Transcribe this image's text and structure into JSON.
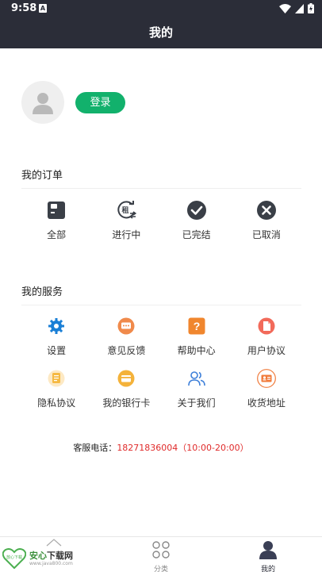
{
  "status_bar": {
    "time": "9:58",
    "notif_letter": "A"
  },
  "header": {
    "title": "我的"
  },
  "profile": {
    "login_label": "登录"
  },
  "orders": {
    "title": "我的订单",
    "items": [
      {
        "label": "全部",
        "icon": "order-box-icon"
      },
      {
        "label": "进行中",
        "icon": "rent-exchange-icon",
        "icon_text": "租"
      },
      {
        "label": "已完结",
        "icon": "check-circle-icon"
      },
      {
        "label": "已取消",
        "icon": "cancel-circle-icon"
      }
    ]
  },
  "services": {
    "title": "我的服务",
    "items": [
      {
        "label": "设置",
        "icon": "gear-icon",
        "color": "#1a7fd6"
      },
      {
        "label": "意见反馈",
        "icon": "chat-bubble-icon",
        "color": "#f08a4b"
      },
      {
        "label": "帮助中心",
        "icon": "question-icon",
        "color": "#f0862e"
      },
      {
        "label": "用户协议",
        "icon": "document-icon",
        "color": "#f26a5a"
      },
      {
        "label": "隐私协议",
        "icon": "privacy-doc-icon",
        "color": "#f5b942"
      },
      {
        "label": "我的银行卡",
        "icon": "bank-card-icon",
        "color": "#f4b23a"
      },
      {
        "label": "关于我们",
        "icon": "people-icon",
        "color": "#3d7fd9"
      },
      {
        "label": "收货地址",
        "icon": "address-card-icon",
        "color": "#f07a3a"
      }
    ]
  },
  "customer_service": {
    "label": "客服电话：",
    "phone": "18271836004（10:00-20:00）"
  },
  "tabbar": {
    "tabs": [
      {
        "label": "分类",
        "icon": "category-icon",
        "active": false
      },
      {
        "label": "我的",
        "icon": "user-icon",
        "active": true
      }
    ]
  },
  "watermark": {
    "brand_green": "安心",
    "brand_dark": "下载网",
    "url": "www.java800.com",
    "badge_text": "放心下载"
  },
  "colors": {
    "header_bg": "#2b2d38",
    "accent_green": "#12b16c",
    "phone_red": "#e02a2a"
  }
}
